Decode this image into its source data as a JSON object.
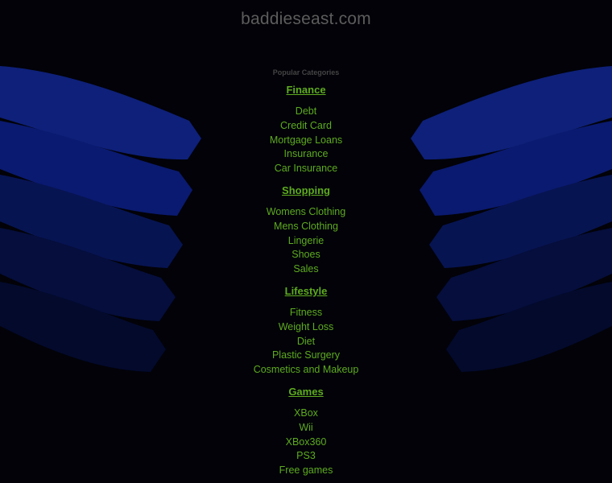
{
  "site": {
    "domain": "baddieseast.com"
  },
  "categories": {
    "heading": "Popular Categories",
    "groups": [
      {
        "title": "Finance",
        "links": [
          "Debt",
          "Credit Card",
          "Mortgage Loans",
          "Insurance",
          "Car Insurance"
        ]
      },
      {
        "title": "Shopping",
        "links": [
          "Womens Clothing",
          "Mens Clothing",
          "Lingerie",
          "Shoes",
          "Sales"
        ]
      },
      {
        "title": "Lifestyle",
        "links": [
          "Fitness",
          "Weight Loss",
          "Diet",
          "Plastic Surgery",
          "Cosmetics and Makeup"
        ]
      },
      {
        "title": "Games",
        "links": [
          "XBox",
          "Wii",
          "XBox360",
          "PS3",
          "Free games"
        ]
      }
    ]
  },
  "colors": {
    "background": "#020208",
    "link": "#5eab1f",
    "title": "#5c5c5c",
    "heading": "#444444"
  }
}
